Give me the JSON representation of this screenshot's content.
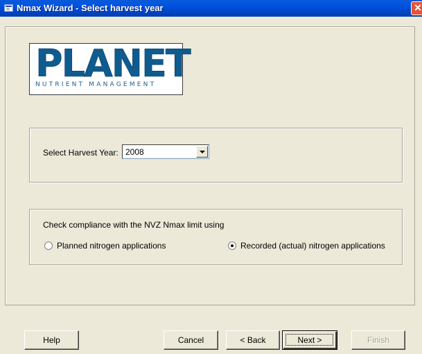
{
  "window": {
    "title": "Nmax Wizard - Select harvest year",
    "close_glyph": "✕"
  },
  "logo": {
    "word": "PLANET",
    "subtitle": "NUTRIENT MANAGEMENT"
  },
  "harvest_year": {
    "label": "Select Harvest Year:",
    "selected": "2008"
  },
  "nvz": {
    "question": "Check compliance with the NVZ Nmax limit using",
    "options": [
      {
        "label": "Planned nitrogen applications",
        "selected": false
      },
      {
        "label": "Recorded (actual) nitrogen applications",
        "selected": true
      }
    ]
  },
  "buttons": {
    "help": "Help",
    "cancel": "Cancel",
    "back": "< Back",
    "next": "Next >",
    "finish": "Finish"
  },
  "colors": {
    "titlebar": "#0054e3",
    "dialog_bg": "#ece9d8",
    "logo_blue": "#0e5c8f",
    "disabled_text": "#a7a592"
  }
}
